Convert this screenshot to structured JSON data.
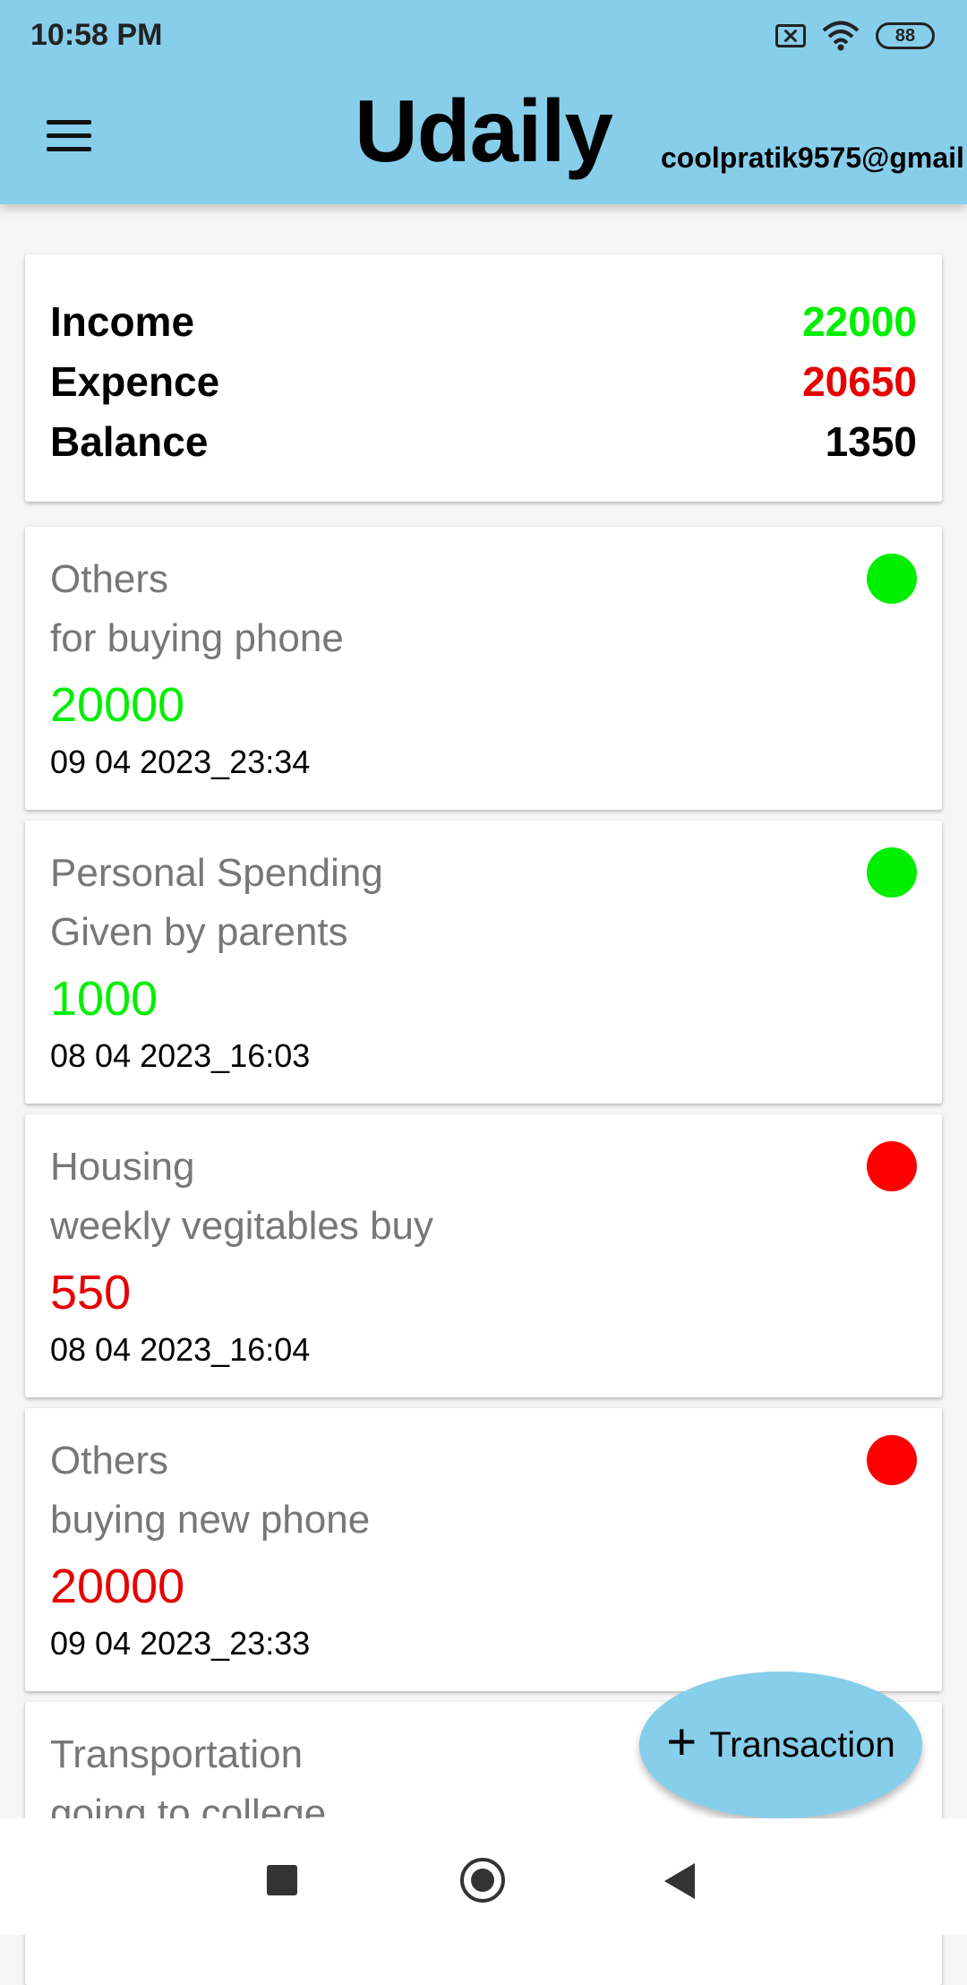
{
  "status_bar": {
    "time": "10:58 PM",
    "battery": "88"
  },
  "app": {
    "title": "Udaily",
    "user_email": "coolpratik9575@gmail"
  },
  "summary": {
    "income_label": "Income",
    "income_value": "22000",
    "expense_label": "Expence",
    "expense_value": "20650",
    "balance_label": "Balance",
    "balance_value": "1350"
  },
  "transactions": [
    {
      "category": "Others",
      "description": "for buying phone",
      "amount": "20000",
      "date": "09 04 2023_23:34",
      "type": "income"
    },
    {
      "category": "Personal Spending",
      "description": "Given by parents",
      "amount": "1000",
      "date": "08 04 2023_16:03",
      "type": "income"
    },
    {
      "category": "Housing",
      "description": "weekly vegitables buy",
      "amount": "550",
      "date": "08 04 2023_16:04",
      "type": "expense"
    },
    {
      "category": "Others",
      "description": "buying new phone",
      "amount": "20000",
      "date": "09 04 2023_23:33",
      "type": "expense"
    },
    {
      "category": "Transportation",
      "description": "going to college",
      "amount": "",
      "date": "",
      "type": ""
    }
  ],
  "fab": {
    "label": "Transaction",
    "icon": "plus-icon"
  },
  "colors": {
    "appbar": "#87CEEB",
    "income": "#00EE00",
    "expense": "#E60000"
  },
  "icons": {
    "menu": "menu-icon",
    "nav_recents": "recents-icon",
    "nav_home": "home-icon",
    "nav_back": "back-icon"
  }
}
